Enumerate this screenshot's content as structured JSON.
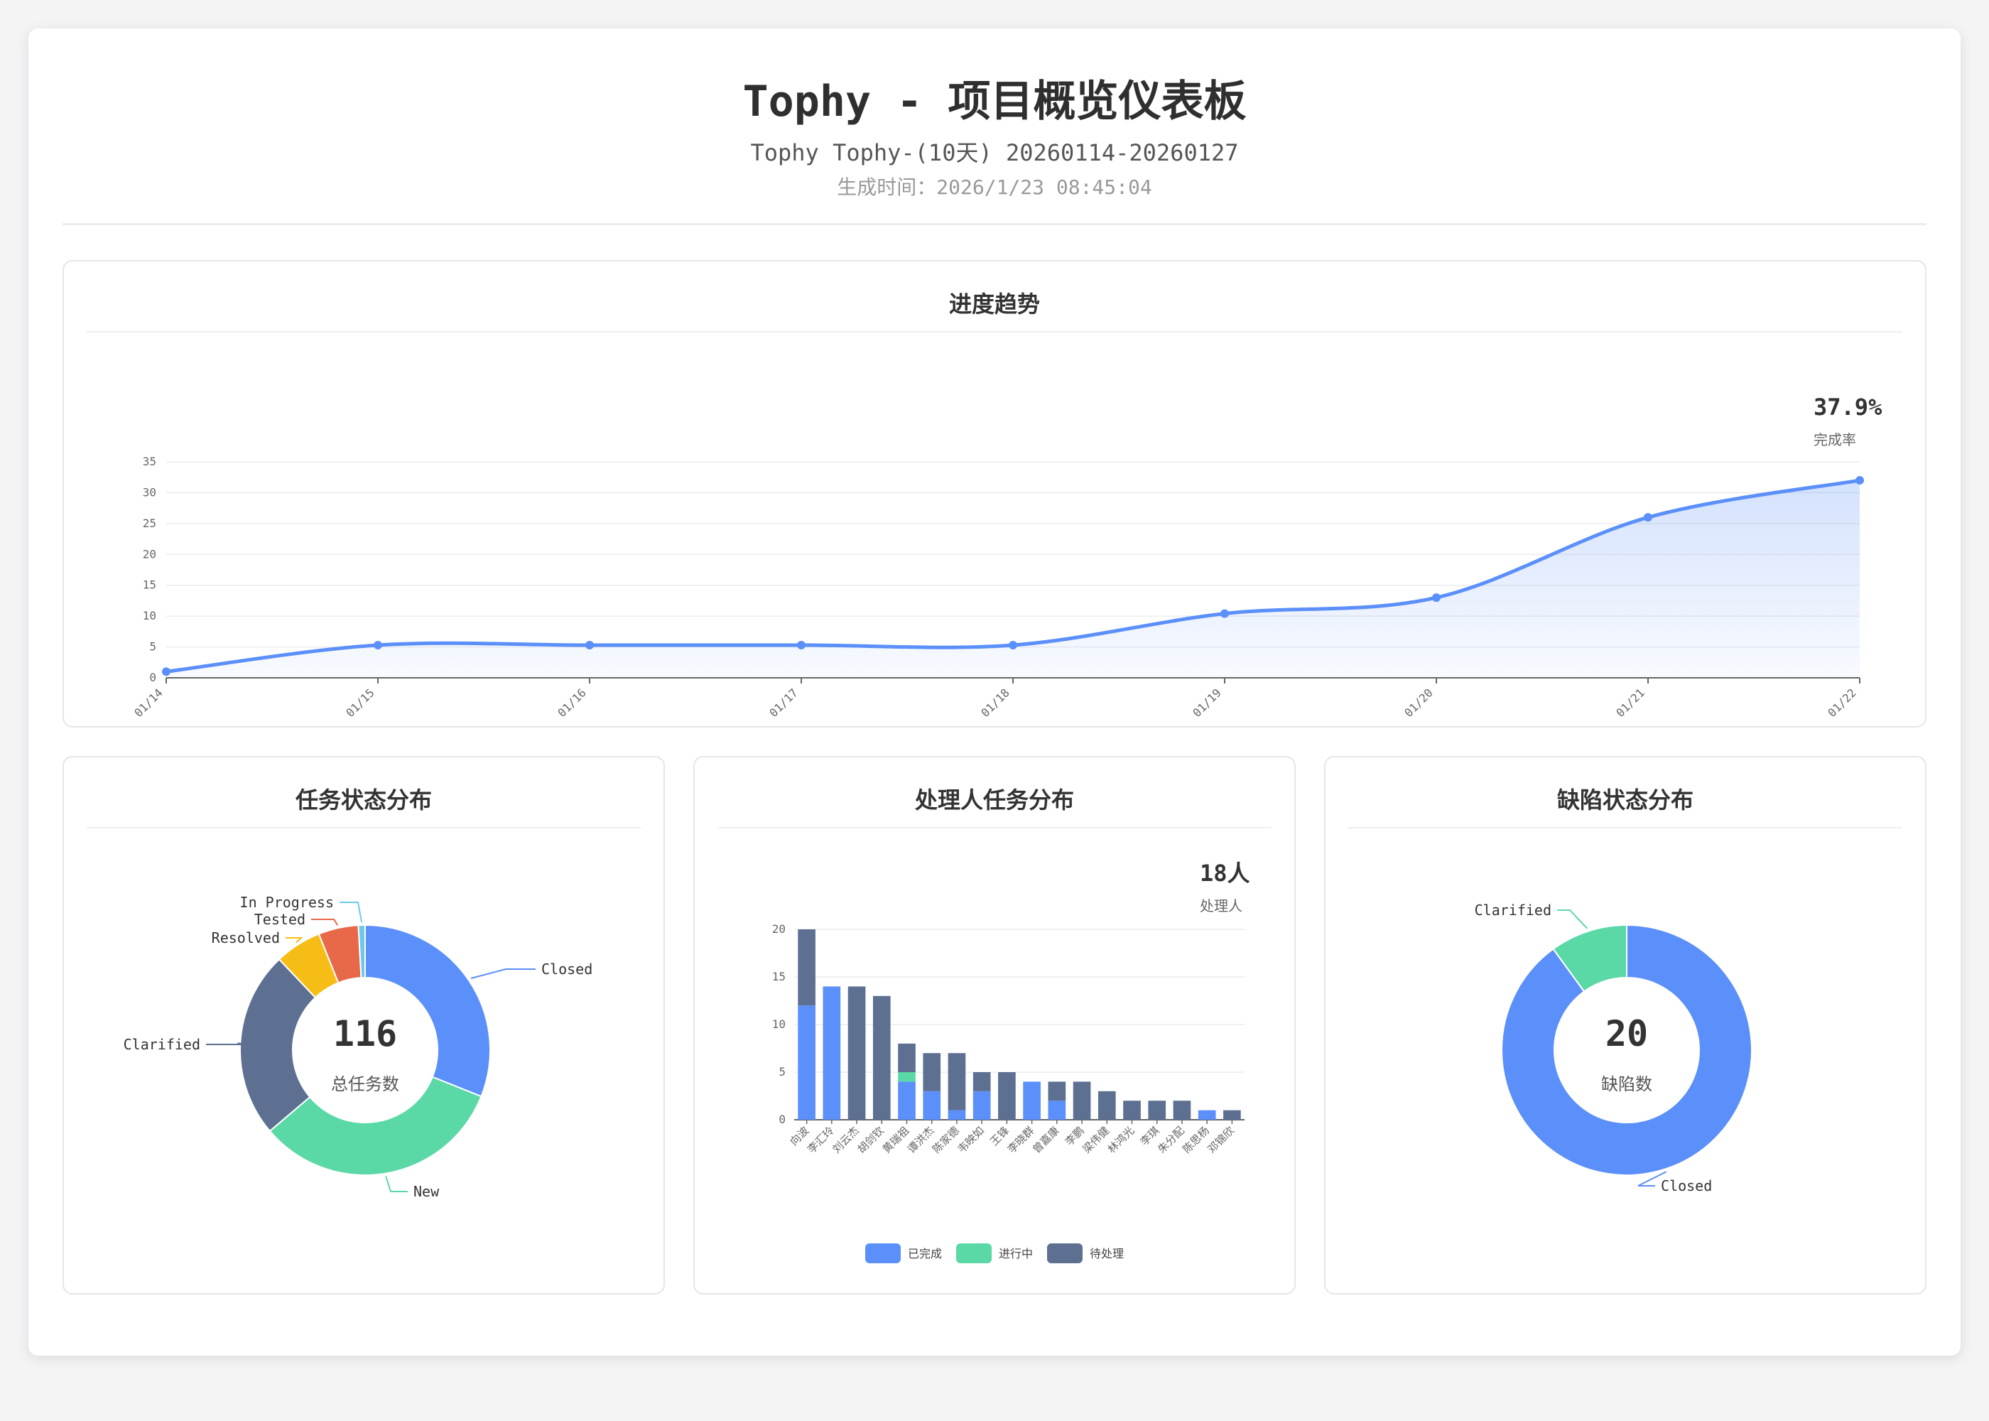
{
  "header": {
    "title": "Tophy - 项目概览仪表板",
    "subtitle": "Tophy Tophy-(10天) 20260114-20260127",
    "generated_label": "生成时间：",
    "generated_value": "2026/1/23 08:45:04"
  },
  "colors": {
    "blue": "#5b8ff9",
    "green": "#5ad8a6",
    "slate": "#5d7092",
    "yellow": "#f6bd16",
    "red": "#e8684a",
    "cyan": "#6dc8ec"
  },
  "trend": {
    "title": "进度趋势",
    "kpi_value": "37.9%",
    "kpi_label": "完成率"
  },
  "status": {
    "title": "任务状态分布",
    "center_value": "116",
    "center_label": "总任务数"
  },
  "assignee": {
    "title": "处理人任务分布",
    "kpi_value": "18人",
    "kpi_label": "处理人"
  },
  "defect": {
    "title": "缺陷状态分布",
    "center_value": "20",
    "center_label": "缺陷数"
  },
  "chart_data": [
    {
      "type": "area",
      "title": "进度趋势",
      "x": [
        "01/14",
        "01/15",
        "01/16",
        "01/17",
        "01/18",
        "01/19",
        "01/20",
        "01/21",
        "01/22"
      ],
      "values": [
        1,
        5.3,
        5.3,
        5.3,
        5.3,
        10.4,
        13,
        26,
        32
      ],
      "ylim": [
        0,
        35
      ],
      "yticks": [
        0,
        5,
        10,
        15,
        20,
        25,
        30,
        35
      ],
      "grid": true
    },
    {
      "type": "pie",
      "title": "任务状态分布",
      "slices": [
        {
          "label": "Closed",
          "value": 36,
          "color": "#5b8ff9"
        },
        {
          "label": "New",
          "value": 38,
          "color": "#5ad8a6"
        },
        {
          "label": "Clarified",
          "value": 28,
          "color": "#5d7092"
        },
        {
          "label": "Resolved",
          "value": 7,
          "color": "#f6bd16"
        },
        {
          "label": "Tested",
          "value": 6,
          "color": "#e8684a"
        },
        {
          "label": "In Progress",
          "value": 1,
          "color": "#6dc8ec"
        }
      ]
    },
    {
      "type": "bar",
      "title": "处理人任务分布",
      "categories": [
        "向波",
        "李汇玲",
        "刘云杰",
        "胡剑钦",
        "黄瑞祖",
        "谭洪杰",
        "陈家德",
        "韦映如",
        "王锋",
        "李晓群",
        "曾嘉康",
        "李鹏",
        "梁伟健",
        "林鸿光",
        "李琪",
        "朱分配",
        "陈思杨",
        "邓锦欣"
      ],
      "series": [
        {
          "name": "已完成",
          "color": "#5b8ff9",
          "values": [
            12,
            14,
            0,
            0,
            4,
            3,
            1,
            3,
            0,
            4,
            2,
            0,
            0,
            0,
            0,
            0,
            1,
            0
          ]
        },
        {
          "name": "进行中",
          "color": "#5ad8a6",
          "values": [
            0,
            0,
            0,
            0,
            1,
            0,
            0,
            0,
            0,
            0,
            0,
            0,
            0,
            0,
            0,
            0,
            0,
            0
          ]
        },
        {
          "name": "待处理",
          "color": "#5d7092",
          "values": [
            8,
            0,
            14,
            13,
            3,
            4,
            6,
            2,
            5,
            0,
            2,
            4,
            3,
            2,
            2,
            2,
            0,
            1
          ]
        }
      ],
      "ylim": [
        0,
        20
      ],
      "yticks": [
        0,
        5,
        10,
        15,
        20
      ],
      "stacked": true,
      "legend": "bottom"
    },
    {
      "type": "pie",
      "title": "缺陷状态分布",
      "slices": [
        {
          "label": "Closed",
          "value": 18,
          "color": "#5b8ff9"
        },
        {
          "label": "Clarified",
          "value": 2,
          "color": "#5ad8a6"
        }
      ]
    }
  ]
}
